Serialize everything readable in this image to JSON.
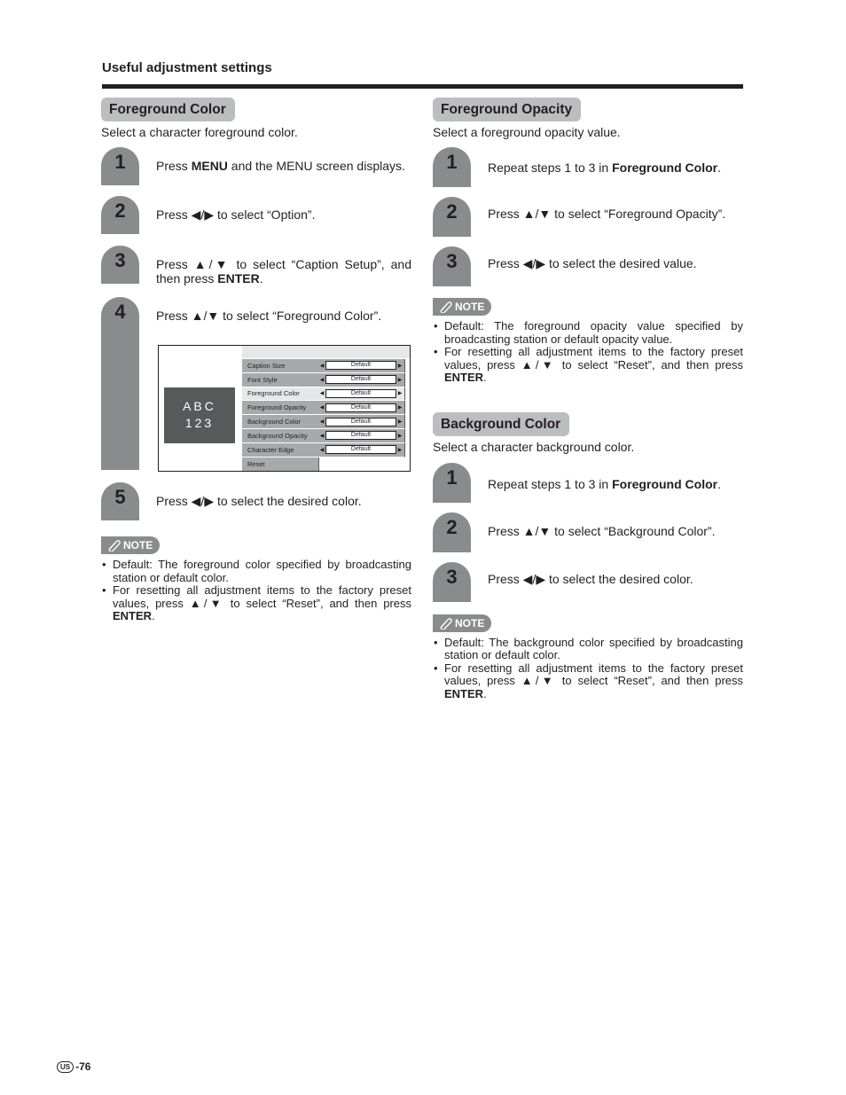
{
  "header": {
    "title": "Useful adjustment settings"
  },
  "colors": {
    "badge": "#8a8b8d",
    "title_bg": "#bcbdbf",
    "rule": "#231f20",
    "preview_bg": "#58595b"
  },
  "sections": {
    "fg_color": {
      "title": "Foreground Color",
      "subtitle": "Select a character foreground color.",
      "steps": [
        {
          "num": "1",
          "pre": "Press ",
          "bold": "MENU",
          "post": " and the MENU screen displays."
        },
        {
          "num": "2",
          "text": "Press ◀/▶ to select “Option”."
        },
        {
          "num": "3",
          "pre": "Press ▲/▼ to select “Caption Setup”, and then press ",
          "bold": "ENTER",
          "post": "."
        },
        {
          "num": "4",
          "text": "Press ▲/▼ to select “Foreground Color”."
        },
        {
          "num": "5",
          "text": "Press ◀/▶ to select the desired color."
        }
      ],
      "note_label": "NOTE",
      "notes": [
        {
          "text": "Default: The foreground color specified by broadcasting station or default color."
        },
        {
          "pre": "For resetting all adjustment items to the factory preset values, press ▲/▼ to select “Reset”, and then press ",
          "bold": "ENTER",
          "post": "."
        }
      ]
    },
    "fg_opacity": {
      "title": "Foreground Opacity",
      "subtitle": "Select a foreground opacity value.",
      "steps": [
        {
          "num": "1",
          "pre": "Repeat steps 1 to 3 in ",
          "bold": "Foreground Color",
          "post": "."
        },
        {
          "num": "2",
          "text": "Press ▲/▼ to select “Foreground Opacity”."
        },
        {
          "num": "3",
          "text": "Press ◀/▶ to select the desired value."
        }
      ],
      "note_label": "NOTE",
      "notes": [
        {
          "text": "Default: The foreground opacity value specified by broadcasting station or default opacity value."
        },
        {
          "pre": "For resetting all adjustment items to the factory preset values, press ▲/▼ to select “Reset”, and then press ",
          "bold": "ENTER",
          "post": "."
        }
      ]
    },
    "bg_color": {
      "title": "Background Color",
      "subtitle": "Select a character background color.",
      "steps": [
        {
          "num": "1",
          "pre": "Repeat steps 1 to 3 in ",
          "bold": "Foreground Color",
          "post": "."
        },
        {
          "num": "2",
          "text": "Press ▲/▼ to select “Background Color”."
        },
        {
          "num": "3",
          "text": "Press ◀/▶ to select the desired color."
        }
      ],
      "note_label": "NOTE",
      "notes": [
        {
          "text": "Default: The background color specified by broadcasting station or default color."
        },
        {
          "pre": "For resetting all adjustment items to the factory preset values, press ▲/▼ to select “Reset”, and then press ",
          "bold": "ENTER",
          "post": "."
        }
      ]
    }
  },
  "menu_screen": {
    "preview_line1": "ABC",
    "preview_line2": "123",
    "arrow_left": "◀",
    "arrow_right": "▶",
    "rows": [
      {
        "label": "Caption Size",
        "value": "Default"
      },
      {
        "label": "Font Style",
        "value": "Default"
      },
      {
        "label": "Foreground Color",
        "value": "Default",
        "active": true
      },
      {
        "label": "Foreground Opacity",
        "value": "Default"
      },
      {
        "label": "Background Color",
        "value": "Default"
      },
      {
        "label": "Background Opacity",
        "value": "Default"
      },
      {
        "label": "Character Edge",
        "value": "Default"
      }
    ],
    "reset_label": "Reset"
  },
  "footer": {
    "region": "US",
    "page": "-76"
  }
}
